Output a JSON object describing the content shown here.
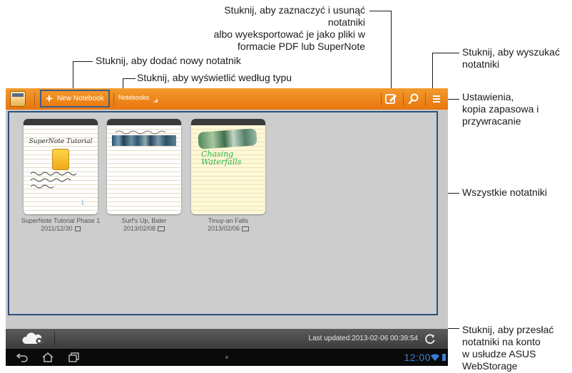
{
  "callouts": {
    "select_delete_export": [
      "Stuknij, aby zaznaczyć i usunąć notatniki",
      "albo wyeksportować je jako pliki w",
      "formacie PDF lub SuperNote"
    ],
    "add_notebook": "Stuknij, aby dodać nowy notatnik",
    "view_by_type": "Stuknij, aby wyświetlić według typu",
    "search": [
      "Stuknij, aby wyszukać",
      "notatniki"
    ],
    "settings": [
      "Ustawienia,",
      "kopia zapasowa i",
      "przywracanie"
    ],
    "all_notebooks": "Wszystkie notatniki",
    "upload": [
      "Stuknij, aby przesłać",
      "notatniki na konto",
      "w usłudze ASUS",
      "WebStorage"
    ]
  },
  "toolbar": {
    "new_notebook_label": "New Notebook",
    "notebooks_dropdown_label": "Notebooks",
    "edit_icon": "edit-select-icon",
    "search_icon": "search-icon",
    "menu_icon": "menu-icon",
    "accent": "#ec8418"
  },
  "notebooks": [
    {
      "name": "SuperNote Tutorial Phase 1",
      "date": "2011/12/30",
      "cover_text": "SuperNote Tutorial"
    },
    {
      "name": "Surf's Up, Baler",
      "date": "2013/02/08"
    },
    {
      "name": "Tinuy-an Falls",
      "date": "2013/02/06",
      "cover_text": "Chasing Waterfalls"
    }
  ],
  "bottombar": {
    "last_updated": "Last updated:2013-02-06 00:39:54",
    "cloud_icon": "cloud-settings-icon",
    "refresh_icon": "refresh-icon"
  },
  "navbar": {
    "clock": "12:00"
  }
}
